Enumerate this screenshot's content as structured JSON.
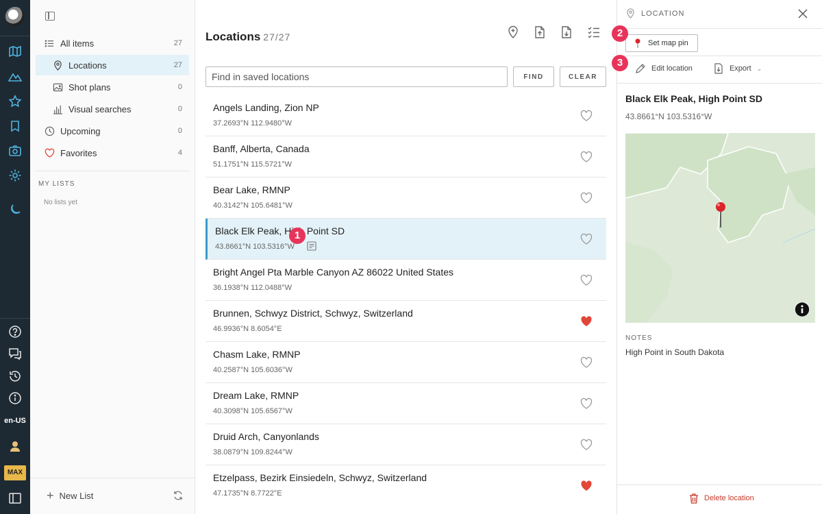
{
  "rail": {
    "locale": "en-US",
    "plan_badge": "MAX"
  },
  "sidebar": {
    "items": [
      {
        "label": "All items",
        "count": "27"
      },
      {
        "label": "Locations",
        "count": "27"
      },
      {
        "label": "Shot plans",
        "count": "0"
      },
      {
        "label": "Visual searches",
        "count": "0"
      },
      {
        "label": "Upcoming",
        "count": "0"
      },
      {
        "label": "Favorites",
        "count": "4"
      }
    ],
    "my_lists_heading": "MY LISTS",
    "empty_text": "No lists yet",
    "new_list_label": "New List"
  },
  "main": {
    "title": "Locations",
    "count": "27/27",
    "search_placeholder": "Find in saved locations",
    "find_label": "FIND",
    "clear_label": "CLEAR",
    "locations": [
      {
        "name": "Angels Landing, Zion NP",
        "coord": "37.2693°N 112.9480°W",
        "favorite": false
      },
      {
        "name": "Banff, Alberta, Canada",
        "coord": "51.1751°N 115.5721°W",
        "favorite": false
      },
      {
        "name": "Bear Lake, RMNP",
        "coord": "40.3142°N 105.6481°W",
        "favorite": false
      },
      {
        "name": "Black Elk Peak, High Point SD",
        "coord": "43.8661°N 103.5316°W",
        "favorite": false,
        "selected": true
      },
      {
        "name": "Bright Angel Pta Marble Canyon AZ 86022 United States",
        "coord": "36.1938°N 112.0488°W",
        "favorite": false
      },
      {
        "name": "Brunnen, Schwyz District, Schwyz, Switzerland",
        "coord": "46.9936°N 8.6054°E",
        "favorite": true
      },
      {
        "name": "Chasm Lake, RMNP",
        "coord": "40.2587°N 105.6036°W",
        "favorite": false
      },
      {
        "name": "Dream Lake, RMNP",
        "coord": "40.3098°N 105.6567°W",
        "favorite": false
      },
      {
        "name": "Druid Arch, Canyonlands",
        "coord": "38.0879°N 109.8244°W",
        "favorite": false
      },
      {
        "name": "Etzelpass, Bezirk Einsiedeln, Schwyz, Switzerland",
        "coord": "47.1735°N 8.7722°E",
        "favorite": true
      }
    ]
  },
  "detail": {
    "header": "LOCATION",
    "set_pin_label": "Set map pin",
    "edit_label": "Edit location",
    "export_label": "Export",
    "name": "Black Elk Peak, High Point SD",
    "coord": "43.8661°N 103.5316°W",
    "notes_heading": "NOTES",
    "notes": "High Point in South Dakota",
    "delete_label": "Delete location"
  },
  "callouts": [
    "1",
    "2",
    "3"
  ],
  "colors": {
    "rail_bg": "#1e2a33",
    "accent": "#3a9bc9",
    "favorite": "#e2463a",
    "callout": "#e8345a"
  }
}
